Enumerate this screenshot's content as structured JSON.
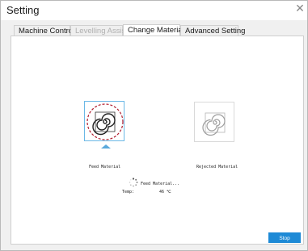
{
  "window": {
    "title": "Setting"
  },
  "tabs": [
    {
      "label": "Machine Control",
      "state": "normal"
    },
    {
      "label": "Levelling Assist",
      "state": "disabled"
    },
    {
      "label": "Change Materials",
      "state": "active"
    },
    {
      "label": "Advanced Setting",
      "state": "normal"
    }
  ],
  "materials": {
    "feed_label": "Feed Material",
    "rejected_label": "Rejected Material"
  },
  "status": {
    "message": "Feed Material...",
    "temp_label": "Temp:",
    "temp_value": "46 ℃"
  },
  "buttons": {
    "stop": "Stop"
  },
  "colors": {
    "accent": "#1e8ad6",
    "selection": "#5aa9dc",
    "dashed_highlight": "#b01c2e"
  }
}
